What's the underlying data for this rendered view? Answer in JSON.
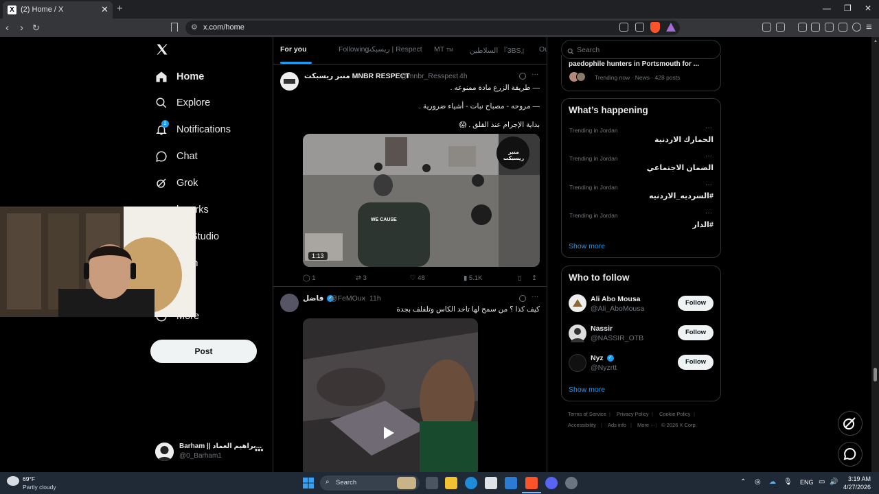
{
  "browser": {
    "tab_title": "(2) Home / X",
    "tab_favicon": "X",
    "url": "x.com/home"
  },
  "sidebar": {
    "items": [
      {
        "label": "Home",
        "icon": "home-icon"
      },
      {
        "label": "Explore",
        "icon": "search-icon"
      },
      {
        "label": "Notifications",
        "icon": "bell-icon",
        "badge": "2"
      },
      {
        "label": "Chat",
        "icon": "chat-icon"
      },
      {
        "label": "Grok",
        "icon": "grok-icon"
      },
      {
        "label": "kmarks",
        "icon": "bookmark-icon"
      },
      {
        "label": "tor Studio",
        "icon": "studio-icon"
      },
      {
        "label": "nium",
        "icon": "premium-icon"
      },
      {
        "label": "le",
        "icon": "profile-icon"
      },
      {
        "label": "More",
        "icon": "more-icon"
      }
    ],
    "post_label": "Post",
    "account": {
      "name": "Barham || براهيم العماد...",
      "handle": "@0_Barham1"
    }
  },
  "feed_tabs": [
    "For you",
    "Following",
    "ريسبكت | Respect",
    "MT",
    "السلاطين 『3BS』",
    "Ou"
  ],
  "feed_tab_tm": "TM",
  "tweets": [
    {
      "name": "منبر ريسبكت MNBR RESPECT",
      "handle": "@mnbr_Resspect",
      "time": "4h",
      "lines": [
        "— طريقة الزرع مادة ممنوعه .",
        "— مروحه - مصباح نبات - أشياء ضرورية .",
        "بداية الإجرام عند القلق . 😱"
      ],
      "video_duration": "1:13",
      "video_logo": "منبر ريسبكت",
      "shirt_text": "WE CAUSE",
      "stats": {
        "replies": "1",
        "reposts": "3",
        "likes": "48",
        "views": "5.1K"
      }
    },
    {
      "name": "فاضل",
      "handle": "@FeMOux",
      "time": "11h",
      "lines": [
        "كيف كذا ؟ من سمح لها تاخد الكاس وتلفلف بجدة"
      ]
    }
  ],
  "search": {
    "placeholder": "Search"
  },
  "trending_top": {
    "title": "paedophile hunters in Portsmouth for ...",
    "meta": "Trending now · News · 428 posts"
  },
  "whats_happening": {
    "title": "What’s happening",
    "items": [
      {
        "meta": "Trending in Jordan",
        "title": "الحمارك الاردنية"
      },
      {
        "meta": "Trending in Jordan",
        "title": "الضمان الاجتماعي"
      },
      {
        "meta": "Trending in Jordan",
        "title": "#السرديه_الاردنيه"
      },
      {
        "meta": "Trending in Jordan",
        "title": "#الدار"
      }
    ],
    "show_more": "Show more"
  },
  "who_to_follow": {
    "title": "Who to follow",
    "people": [
      {
        "name": "Ali Abo Mousa",
        "handle": "@Ali_AboMousa",
        "verified": false
      },
      {
        "name": "Nassir",
        "handle": "@NASSIR_OTB",
        "verified": false
      },
      {
        "name": "Nyz",
        "handle": "@Nyzrtt",
        "verified": true
      }
    ],
    "follow_label": "Follow",
    "show_more": "Show more"
  },
  "footer": {
    "links": [
      "Terms of Service",
      "Privacy Policy",
      "Cookie Policy",
      "Accessibility",
      "Ads info",
      "More ···"
    ],
    "copyright": "© 2026 X Corp."
  },
  "taskbar": {
    "weather_temp": "69°F",
    "weather_desc": "Partly cloudy",
    "search_label": "Search",
    "lang": "ENG",
    "time": "3:19 AM",
    "date": "4/27/2026"
  },
  "colors": {
    "accent": "#1d9bf0",
    "background": "#000000",
    "border": "#2f3336"
  }
}
